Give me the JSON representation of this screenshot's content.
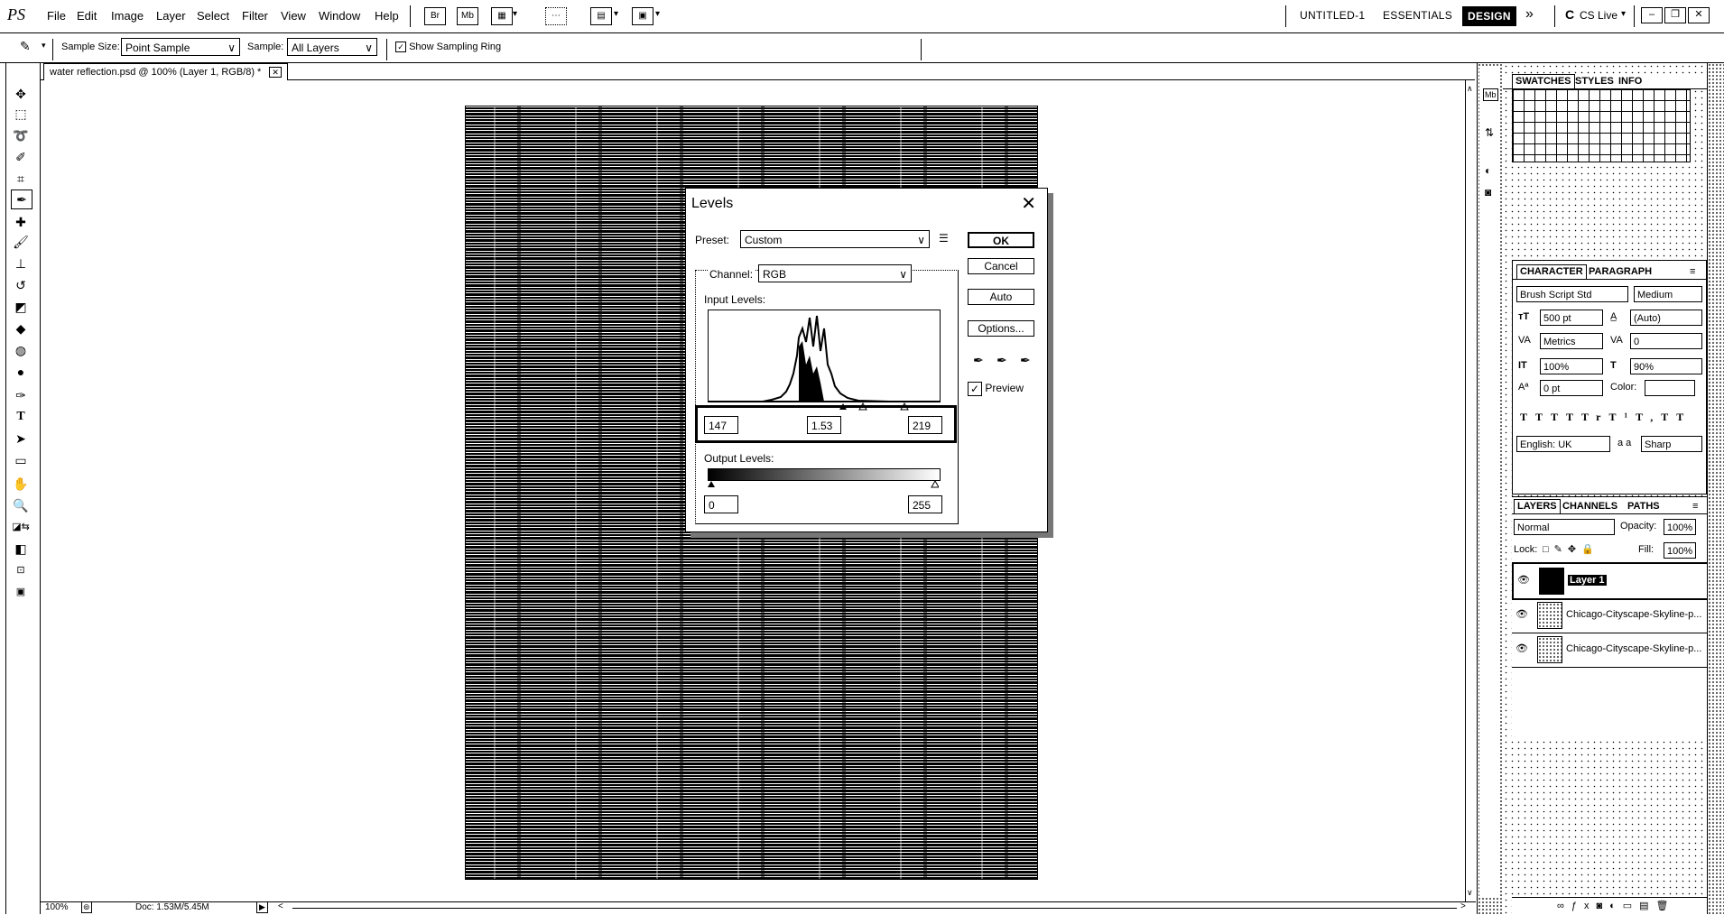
{
  "app": {
    "logo": "PS",
    "menu": [
      "File",
      "Edit",
      "Image",
      "Layer",
      "Select",
      "Filter",
      "View",
      "Window",
      "Help"
    ],
    "workspaces": [
      "UNTITLED-1",
      "ESSENTIALS",
      "DESIGN"
    ],
    "active_workspace": "DESIGN",
    "cs_live": "CS Live"
  },
  "options_bar": {
    "sample_size_label": "Sample Size:",
    "sample_size_value": "Point Sample",
    "sample_label": "Sample:",
    "sample_value": "All Layers",
    "show_ring_label": "Show Sampling Ring",
    "show_ring_checked": true
  },
  "document": {
    "tab_title": "water reflection.psd @ 100% (Layer 1, RGB/8) *",
    "zoom": "100%",
    "doc_info": "Doc: 1.53M/5.45M"
  },
  "levels_dialog": {
    "title": "Levels",
    "preset_label": "Preset:",
    "preset_value": "Custom",
    "channel_label": "Channel:",
    "channel_value": "RGB",
    "input_levels_label": "Input Levels:",
    "input_black": "147",
    "input_gamma": "1.53",
    "input_white": "219",
    "output_levels_label": "Output Levels:",
    "output_black": "0",
    "output_white": "255",
    "buttons": {
      "ok": "OK",
      "cancel": "Cancel",
      "auto": "Auto",
      "options": "Options..."
    },
    "preview_label": "Preview",
    "preview_checked": true
  },
  "panels": {
    "top_tabs": [
      "SWATCHES",
      "STYLES",
      "INFO"
    ],
    "character_tabs": [
      "CHARACTER",
      "PARAGRAPH"
    ],
    "character": {
      "font_family": "Brush Script Std",
      "font_style": "Medium",
      "font_size": "500 pt",
      "leading": "(Auto)",
      "kerning": "Metrics",
      "tracking": "0",
      "vertical_scale": "100%",
      "horizontal_scale": "90%",
      "baseline_shift": "0 pt",
      "color_label": "Color:",
      "language": "English: UK",
      "aa_label": "a a",
      "anti_alias": "Sharp",
      "type_styles": [
        "T",
        "T",
        "TT",
        "Tr",
        "T¹",
        "T,",
        "T",
        "T"
      ]
    },
    "layers_tabs": [
      "LAYERS",
      "CHANNELS",
      "PATHS"
    ],
    "layers": {
      "blend_mode": "Normal",
      "opacity_label": "Opacity:",
      "opacity": "100%",
      "lock_label": "Lock:",
      "fill_label": "Fill:",
      "fill": "100%",
      "items": [
        {
          "name": "Layer 1",
          "selected": true
        },
        {
          "name": "Chicago-Cityscape-Skyline-p...",
          "selected": false
        },
        {
          "name": "Chicago-Cityscape-Skyline-p...",
          "selected": false
        }
      ]
    }
  }
}
